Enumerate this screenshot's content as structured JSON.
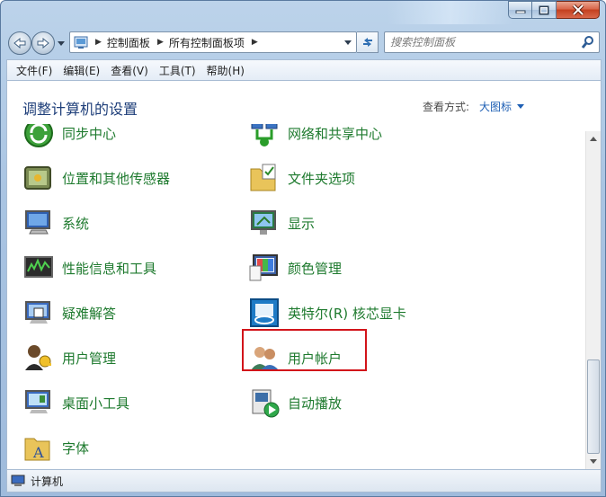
{
  "window": {
    "minimize_icon": "minimize-icon",
    "maximize_icon": "maximize-icon",
    "close_icon": "close-icon"
  },
  "address": {
    "crumbs": [
      "控制面板",
      "所有控制面板项"
    ],
    "search_placeholder": "搜索控制面板"
  },
  "menu": [
    "文件(F)",
    "编辑(E)",
    "查看(V)",
    "工具(T)",
    "帮助(H)"
  ],
  "header": {
    "title": "调整计算机的设置",
    "view_label": "查看方式:",
    "view_value": "大图标"
  },
  "items": [
    {
      "label": "同步中心",
      "icon": "sync-center-icon"
    },
    {
      "label": "网络和共享中心",
      "icon": "network-icon"
    },
    {
      "label": "位置和其他传感器",
      "icon": "sensor-icon"
    },
    {
      "label": "文件夹选项",
      "icon": "folder-options-icon"
    },
    {
      "label": "系统",
      "icon": "system-icon"
    },
    {
      "label": "显示",
      "icon": "display-icon"
    },
    {
      "label": "性能信息和工具",
      "icon": "performance-icon"
    },
    {
      "label": "颜色管理",
      "icon": "color-management-icon"
    },
    {
      "label": "疑难解答",
      "icon": "troubleshoot-icon"
    },
    {
      "label": "英特尔(R) 核芯显卡",
      "icon": "intel-graphics-icon"
    },
    {
      "label": "用户管理",
      "icon": "user-management-icon"
    },
    {
      "label": "用户帐户",
      "icon": "user-accounts-icon"
    },
    {
      "label": "桌面小工具",
      "icon": "gadgets-icon"
    },
    {
      "label": "自动播放",
      "icon": "autoplay-icon"
    },
    {
      "label": "字体",
      "icon": "fonts-icon"
    }
  ],
  "highlighted_item": "颜色管理",
  "status": {
    "text": "计算机"
  },
  "colors": {
    "link_green": "#1e7a2e",
    "title_blue": "#1f3f7a",
    "highlight_red": "#d2141a"
  }
}
